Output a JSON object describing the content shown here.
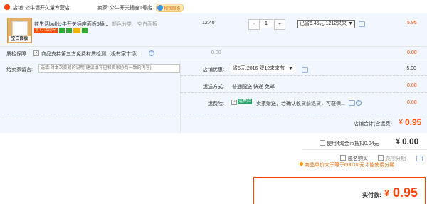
{
  "store": {
    "shop_label": "店铺:",
    "shop_name": "公牛墙开久量专营店",
    "seller_label": "卖家:",
    "seller_name": "公牛开关插座1号店",
    "contact_label": "和我联系"
  },
  "item": {
    "thumb_text": "空白面板",
    "title": "兹生活bull公牛开关插座面板5插...",
    "color_label": "颜色分类:",
    "color_value": "空白面板",
    "promo_tag": "双12活动节",
    "price": "12.40",
    "qty_minus": "-",
    "qty_value": "1",
    "qty_plus": "+",
    "discount_select": "已省6.45元:1212来来",
    "subtotal": "5.95"
  },
  "guarantee": {
    "label": "质检保障",
    "text": "商品支持第三方免费材质检测（极有家市场）",
    "price": "0.00",
    "subtotal": "0.00"
  },
  "message": {
    "label": "给卖家留言:",
    "placeholder": "选填:对本次交易的说明(建议填写已和卖家协商一致的内容)"
  },
  "shop_promo": {
    "label": "店铺优惠:",
    "select": "省5元:2016 双12来来节",
    "value": "-5.00"
  },
  "shipping": {
    "label": "运送方式:",
    "method": "普通配送 快递 免邮",
    "value": "0.00"
  },
  "insurance": {
    "label": "运费险:",
    "badge": "运费险",
    "text": "卖家赠送，若确认收货前退货，可获保...",
    "value": "0.00"
  },
  "shop_total": {
    "label": "店铺合计(含运费)",
    "currency": "¥",
    "value": "0.95"
  },
  "coins": {
    "label": "使用4淘金币抵扣0.04元",
    "currency": "¥",
    "value": "0.00"
  },
  "options": {
    "anonymous": "匿名购买",
    "installment": "花呗分期",
    "installment_note": "商品单价大于等于600.00元才能使用分期"
  },
  "pay": {
    "label": "实付款:",
    "currency": "¥",
    "value": "0.95"
  }
}
